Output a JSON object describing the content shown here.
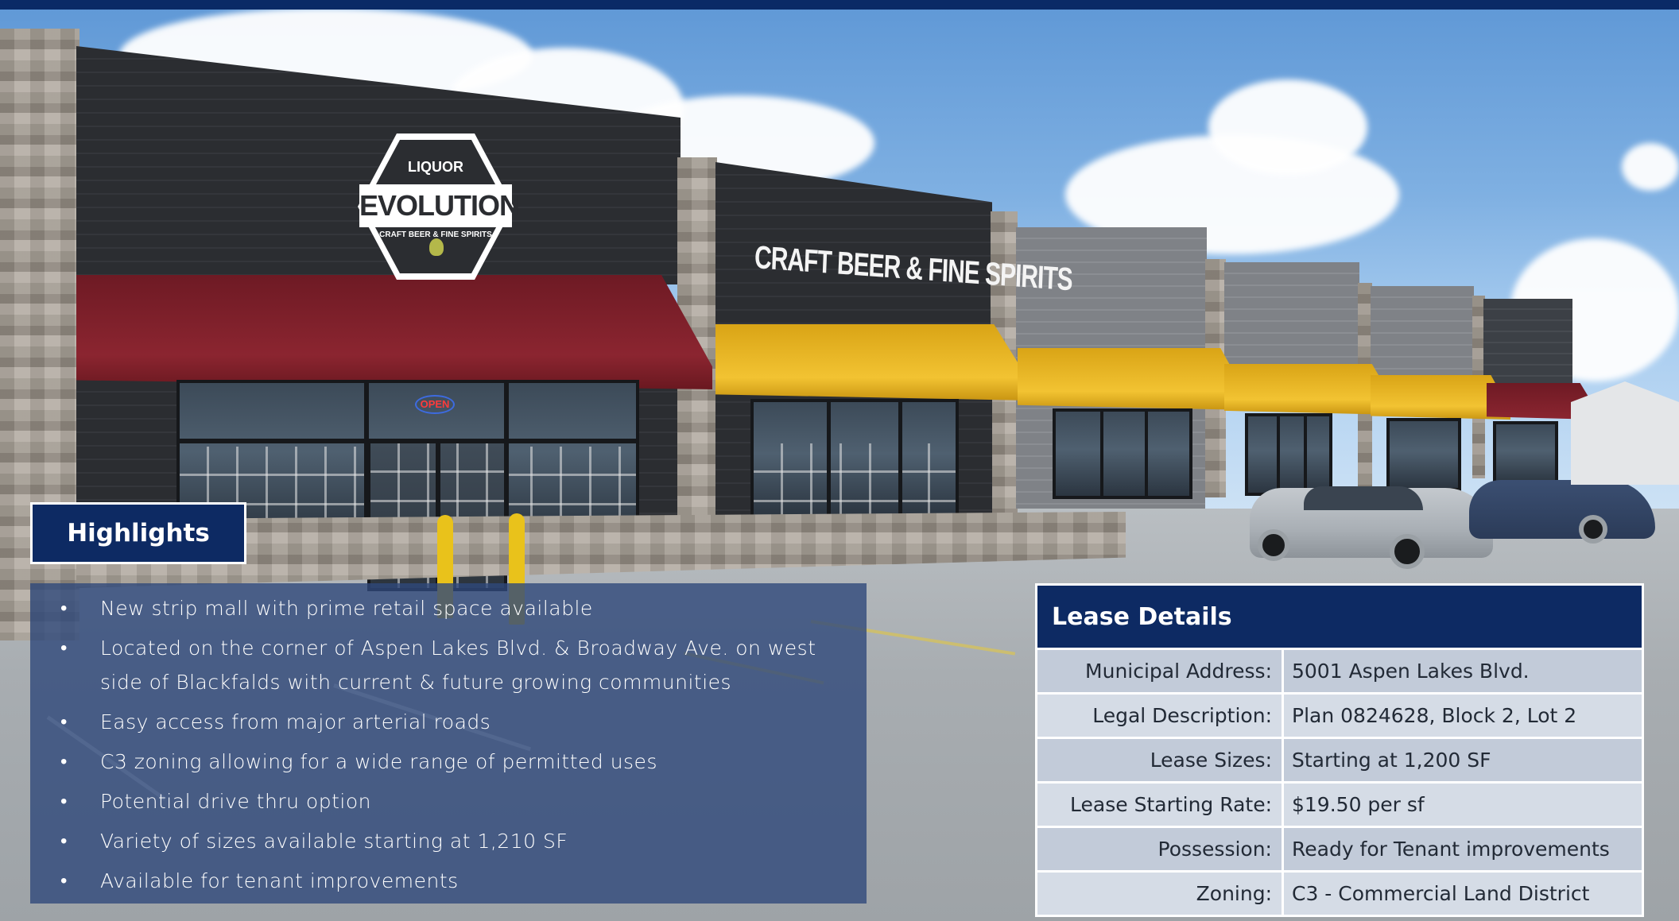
{
  "photo": {
    "logo": {
      "top_word": "LIQUOR",
      "brand": "EVOLUTION",
      "tagline": "CRAFT BEER & FINE SPIRITS"
    },
    "storefront_sign": "CRAFT BEER & FINE SPIRITS",
    "open_sign": "OPEN"
  },
  "highlights": {
    "title": "Highlights",
    "items": [
      "New strip mall with prime retail space available",
      "Located on the corner of Aspen Lakes Blvd. & Broadway Ave. on west side of Blackfalds with current & future growing communities",
      "Easy access from major arterial roads",
      "C3 zoning allowing for a wide range of permitted uses",
      "Potential drive thru option",
      "Variety of sizes available starting at 1,210 SF",
      "Available for tenant improvements"
    ]
  },
  "lease": {
    "title": "Lease Details",
    "rows": [
      {
        "label": "Municipal Address:",
        "value": "5001 Aspen Lakes Blvd."
      },
      {
        "label": "Legal Description:",
        "value": "Plan 0824628, Block 2, Lot 2"
      },
      {
        "label": "Lease Sizes:",
        "value": "Starting at 1,200 SF"
      },
      {
        "label": "Lease Starting Rate:",
        "value": "$19.50 per sf"
      },
      {
        "label": "Possession:",
        "value": "Ready for Tenant improvements"
      },
      {
        "label": "Zoning:",
        "value": "C3 - Commercial Land District"
      }
    ]
  },
  "colors": {
    "navy": "#0d2a63",
    "overlay_blue": "#30487a",
    "table_row_a": "#c2cbd9",
    "table_row_b": "#d5dce6"
  }
}
